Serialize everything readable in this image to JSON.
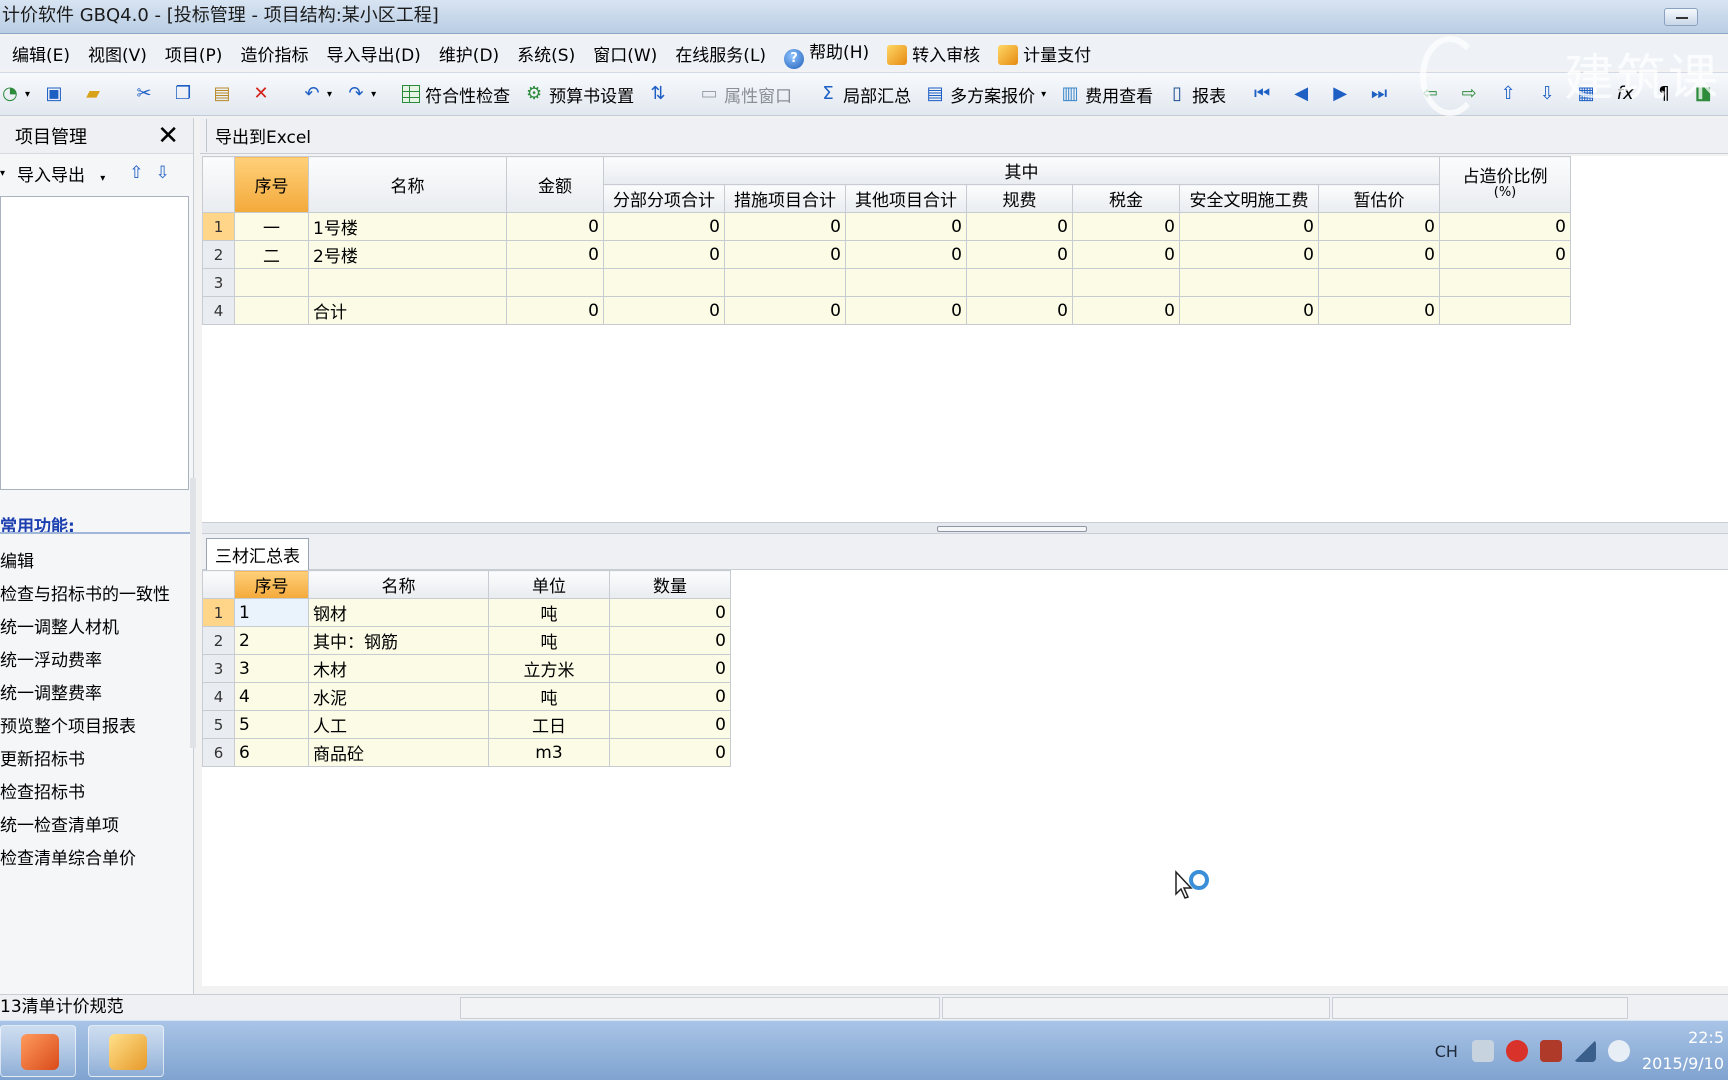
{
  "window": {
    "title": "计价软件 GBQ4.0 - [投标管理 - 项目结构:某小区工程]"
  },
  "menu": {
    "items": [
      "编辑(E)",
      "视图(V)",
      "项目(P)",
      "造价指标",
      "导入导出(D)",
      "维护(D)",
      "系统(S)",
      "窗口(W)",
      "在线服务(L)"
    ],
    "help": "帮助(H)",
    "audit": "转入审核",
    "pay": "计量支付"
  },
  "toolbar": {
    "check": "符合性检查",
    "budget_settings": "预算书设置",
    "properties": "属性窗口",
    "partial_summary": "局部汇总",
    "multi_quote": "多方案报价",
    "fee_view": "费用查看",
    "report": "报表"
  },
  "watermark": "建筑课",
  "left_panel": {
    "title": "项目管理",
    "import_export": "导入导出",
    "functions_title": "常用功能:",
    "functions": [
      "编辑",
      "检查与招标书的一致性",
      "统一调整人材机",
      "统一浮动费率",
      "统一调整费率",
      "预览整个项目报表",
      "更新招标书",
      "检查招标书",
      "统一检查清单项",
      "检查清单综合单价"
    ]
  },
  "main": {
    "export_excel": "导出到Excel",
    "summary_table": {
      "headers": {
        "seq": "序号",
        "name": "名称",
        "amount": "金额",
        "of_which": "其中",
        "sub_items": [
          "分部分项合计",
          "措施项目合计",
          "其他项目合计",
          "规费",
          "税金",
          "安全文明施工费",
          "暂估价"
        ],
        "ratio": "占造价比例",
        "ratio_unit": "(%)"
      },
      "rows": [
        {
          "rn": "1",
          "seq": "一",
          "name": "1号楼",
          "amount": "0",
          "vals": [
            "0",
            "0",
            "0",
            "0",
            "0",
            "0",
            "0"
          ],
          "ratio": "0"
        },
        {
          "rn": "2",
          "seq": "二",
          "name": "2号楼",
          "amount": "0",
          "vals": [
            "0",
            "0",
            "0",
            "0",
            "0",
            "0",
            "0"
          ],
          "ratio": "0"
        },
        {
          "rn": "3",
          "seq": "",
          "name": "",
          "amount": "",
          "vals": [
            "",
            "",
            "",
            "",
            "",
            "",
            ""
          ],
          "ratio": ""
        },
        {
          "rn": "4",
          "seq": "",
          "name": "合计",
          "amount": "0",
          "vals": [
            "0",
            "0",
            "0",
            "0",
            "0",
            "0",
            "0"
          ],
          "ratio": ""
        }
      ]
    },
    "bottom_tab": "三材汇总表",
    "materials_table": {
      "headers": [
        "序号",
        "名称",
        "单位",
        "数量"
      ],
      "rows": [
        {
          "rn": "1",
          "seq": "1",
          "name": "钢材",
          "unit": "吨",
          "qty": "0"
        },
        {
          "rn": "2",
          "seq": "2",
          "name": "其中：钢筋",
          "unit": "吨",
          "qty": "0"
        },
        {
          "rn": "3",
          "seq": "3",
          "name": "木材",
          "unit": "立方米",
          "qty": "0"
        },
        {
          "rn": "4",
          "seq": "4",
          "name": "水泥",
          "unit": "吨",
          "qty": "0"
        },
        {
          "rn": "5",
          "seq": "5",
          "name": "人工",
          "unit": "工日",
          "qty": "0"
        },
        {
          "rn": "6",
          "seq": "6",
          "name": "商品砼",
          "unit": "m3",
          "qty": "0"
        }
      ]
    }
  },
  "status": {
    "spec": "13清单计价规范"
  },
  "taskbar": {
    "lang": "CH",
    "time": "22:5",
    "date": "2015/9/10"
  }
}
